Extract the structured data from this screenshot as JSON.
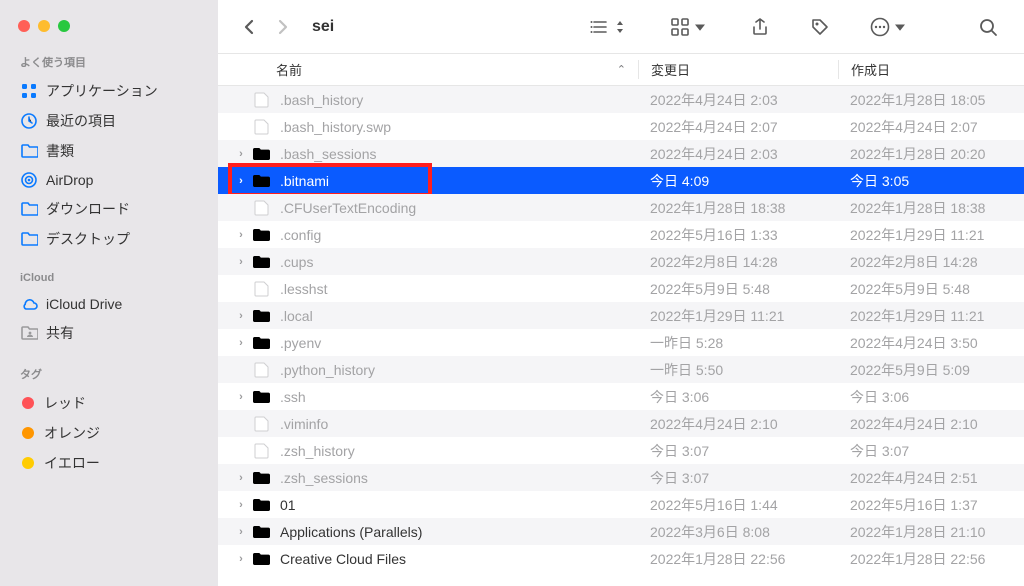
{
  "window_title": "sei",
  "sidebar": {
    "sections": [
      {
        "title": "よく使う項目",
        "items": [
          {
            "icon": "app-grid-icon",
            "label": "アプリケーション"
          },
          {
            "icon": "clock-icon",
            "label": "最近の項目"
          },
          {
            "icon": "folder-icon",
            "label": "書類"
          },
          {
            "icon": "airdrop-icon",
            "label": "AirDrop"
          },
          {
            "icon": "folder-icon",
            "label": "ダウンロード"
          },
          {
            "icon": "folder-icon",
            "label": "デスクトップ"
          }
        ]
      },
      {
        "title": "iCloud",
        "items": [
          {
            "icon": "cloud-icon",
            "label": "iCloud Drive"
          },
          {
            "icon": "share-folder-icon",
            "label": "共有",
            "dim": true
          }
        ]
      },
      {
        "title": "タグ",
        "items": [
          {
            "color": "#ff5257",
            "label": "レッド"
          },
          {
            "color": "#ff9600",
            "label": "オレンジ"
          },
          {
            "color": "#ffcc02",
            "label": "イエロー"
          }
        ]
      }
    ]
  },
  "columns": {
    "name": "名前",
    "modified": "変更日",
    "created": "作成日"
  },
  "files": [
    {
      "type": "file",
      "name": ".bash_history",
      "mod": "2022年4月24日 2:03",
      "created": "2022年1月28日 18:05",
      "dim": true
    },
    {
      "type": "file",
      "name": ".bash_history.swp",
      "mod": "2022年4月24日 2:07",
      "created": "2022年4月24日 2:07",
      "dim": true
    },
    {
      "type": "folder",
      "name": ".bash_sessions",
      "mod": "2022年4月24日 2:03",
      "created": "2022年1月28日 20:20",
      "dim": true,
      "expandable": true
    },
    {
      "type": "folder",
      "name": ".bitnami",
      "mod": "今日 4:09",
      "created": "今日 3:05",
      "selected": true,
      "expandable": true,
      "highlight": true
    },
    {
      "type": "file",
      "name": ".CFUserTextEncoding",
      "mod": "2022年1月28日 18:38",
      "created": "2022年1月28日 18:38",
      "dim": true
    },
    {
      "type": "folder",
      "name": ".config",
      "mod": "2022年5月16日 1:33",
      "created": "2022年1月29日 11:21",
      "dim": true,
      "expandable": true
    },
    {
      "type": "folder",
      "name": ".cups",
      "mod": "2022年2月8日 14:28",
      "created": "2022年2月8日 14:28",
      "dim": true,
      "expandable": true
    },
    {
      "type": "file",
      "name": ".lesshst",
      "mod": "2022年5月9日 5:48",
      "created": "2022年5月9日 5:48",
      "dim": true
    },
    {
      "type": "folder",
      "name": ".local",
      "mod": "2022年1月29日 11:21",
      "created": "2022年1月29日 11:21",
      "dim": true,
      "expandable": true
    },
    {
      "type": "folder",
      "name": ".pyenv",
      "mod": "一昨日 5:28",
      "created": "2022年4月24日 3:50",
      "dim": true,
      "expandable": true
    },
    {
      "type": "file",
      "name": ".python_history",
      "mod": "一昨日 5:50",
      "created": "2022年5月9日 5:09",
      "dim": true
    },
    {
      "type": "folder",
      "name": ".ssh",
      "mod": "今日 3:06",
      "created": "今日 3:06",
      "dim": true,
      "expandable": true
    },
    {
      "type": "file",
      "name": ".viminfo",
      "mod": "2022年4月24日 2:10",
      "created": "2022年4月24日 2:10",
      "dim": true
    },
    {
      "type": "file",
      "name": ".zsh_history",
      "mod": "今日 3:07",
      "created": "今日 3:07",
      "dim": true
    },
    {
      "type": "folder",
      "name": ".zsh_sessions",
      "mod": "今日 3:07",
      "created": "2022年4月24日 2:51",
      "dim": true,
      "expandable": true
    },
    {
      "type": "folder",
      "name": "01",
      "mod": "2022年5月16日 1:44",
      "created": "2022年5月16日 1:37",
      "expandable": true
    },
    {
      "type": "folder",
      "name": "Applications (Parallels)",
      "mod": "2022年3月6日 8:08",
      "created": "2022年1月28日 21:10",
      "expandable": true
    },
    {
      "type": "folder",
      "name": "Creative Cloud Files",
      "mod": "2022年1月28日 22:56",
      "created": "2022年1月28日 22:56",
      "expandable": true
    }
  ]
}
